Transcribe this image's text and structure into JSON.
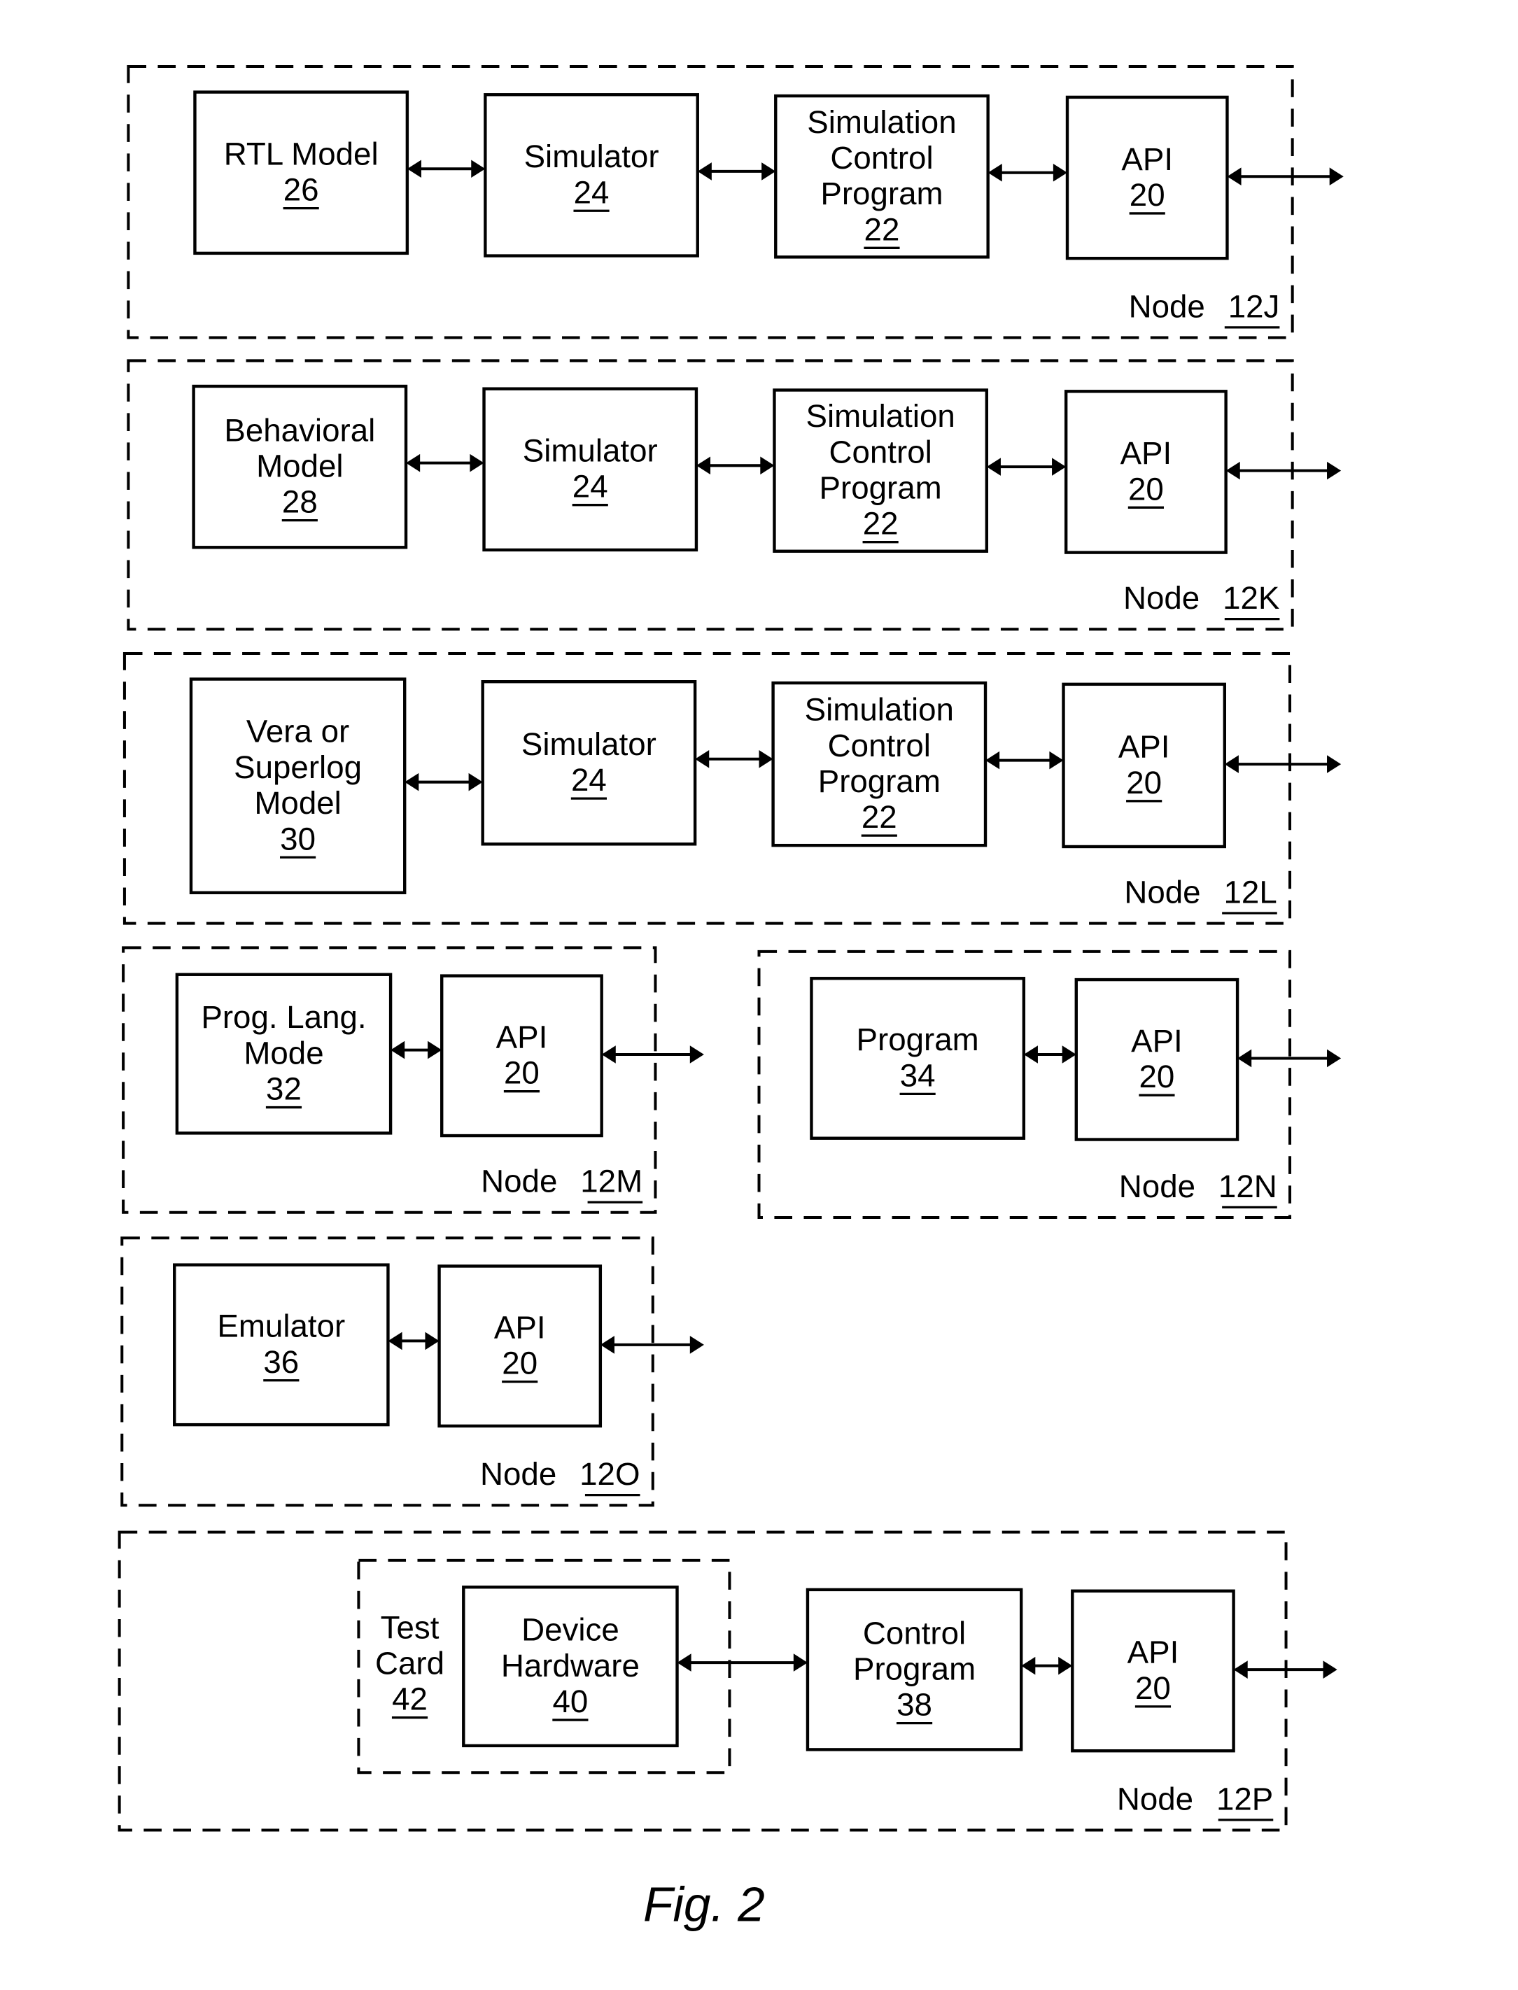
{
  "figure_caption": "Fig. 2",
  "nodes": [
    {
      "label": "Node",
      "ref": "12J",
      "blocks": [
        {
          "lines": [
            "RTL Model"
          ],
          "ref": "26"
        },
        {
          "lines": [
            "Simulator"
          ],
          "ref": "24"
        },
        {
          "lines": [
            "Simulation",
            "Control",
            "Program"
          ],
          "ref": "22"
        },
        {
          "lines": [
            "API"
          ],
          "ref": "20"
        }
      ]
    },
    {
      "label": "Node",
      "ref": "12K",
      "blocks": [
        {
          "lines": [
            "Behavioral",
            "Model"
          ],
          "ref": "28"
        },
        {
          "lines": [
            "Simulator"
          ],
          "ref": "24"
        },
        {
          "lines": [
            "Simulation",
            "Control",
            "Program"
          ],
          "ref": "22"
        },
        {
          "lines": [
            "API"
          ],
          "ref": "20"
        }
      ]
    },
    {
      "label": "Node",
      "ref": "12L",
      "blocks": [
        {
          "lines": [
            "Vera or",
            "Superlog",
            "Model"
          ],
          "ref": "30"
        },
        {
          "lines": [
            "Simulator"
          ],
          "ref": "24"
        },
        {
          "lines": [
            "Simulation",
            "Control",
            "Program"
          ],
          "ref": "22"
        },
        {
          "lines": [
            "API"
          ],
          "ref": "20"
        }
      ]
    },
    {
      "label": "Node",
      "ref": "12M",
      "blocks": [
        {
          "lines": [
            "Prog. Lang.",
            "Mode"
          ],
          "ref": "32"
        },
        {
          "lines": [
            "API"
          ],
          "ref": "20"
        }
      ]
    },
    {
      "label": "Node",
      "ref": "12N",
      "blocks": [
        {
          "lines": [
            "Program"
          ],
          "ref": "34"
        },
        {
          "lines": [
            "API"
          ],
          "ref": "20"
        }
      ]
    },
    {
      "label": "Node",
      "ref": "12O",
      "blocks": [
        {
          "lines": [
            "Emulator"
          ],
          "ref": "36"
        },
        {
          "lines": [
            "API"
          ],
          "ref": "20"
        }
      ]
    },
    {
      "label": "Node",
      "ref": "12P",
      "sub_group": {
        "lines": [
          "Test",
          "Card"
        ],
        "ref": "42"
      },
      "blocks": [
        {
          "lines": [
            "Device",
            "Hardware"
          ],
          "ref": "40"
        },
        {
          "lines": [
            "Control",
            "Program"
          ],
          "ref": "38"
        },
        {
          "lines": [
            "API"
          ],
          "ref": "20"
        }
      ]
    }
  ]
}
